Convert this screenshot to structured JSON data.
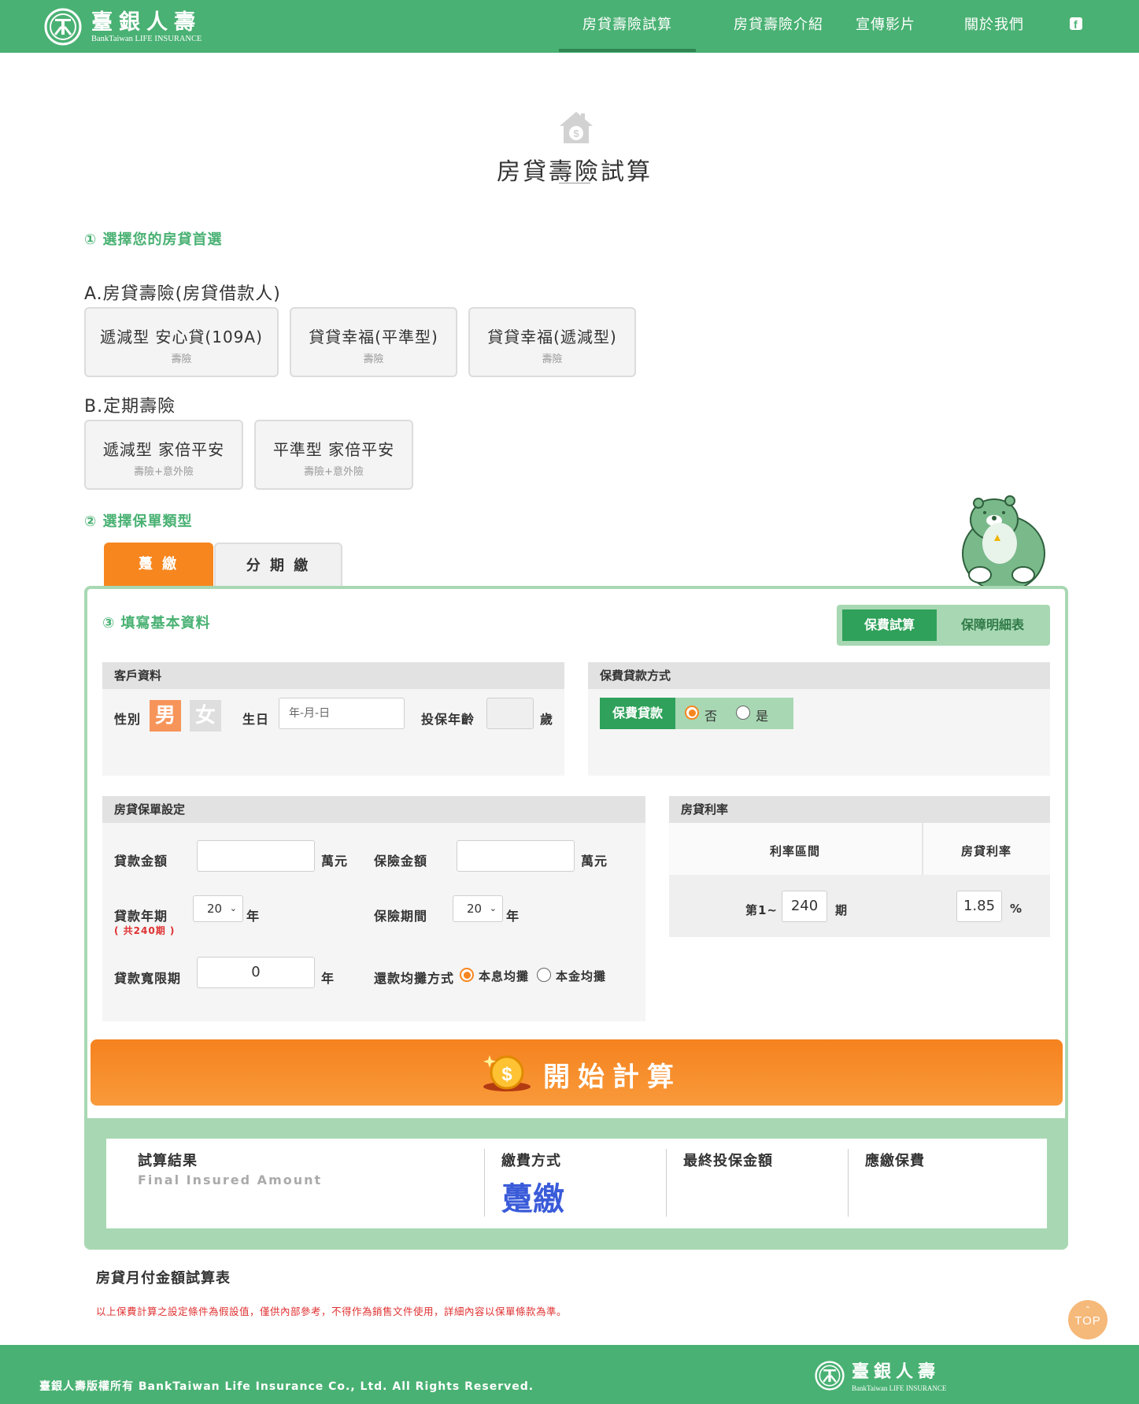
{
  "header": {
    "brand_cn": "臺銀人壽",
    "brand_en": "BankTaiwan LIFE INSURANCE",
    "nav": [
      "房貸壽險試算",
      "房貸壽險介紹",
      "宣傳影片",
      "關於我們"
    ]
  },
  "page_title": "房貸壽險試算",
  "step1": {
    "title": "① 選擇您的房貸首選",
    "group_a": {
      "title": "A.房貸壽險(房貸借款人)",
      "products": [
        {
          "name": "遞減型 安心貸(109A)",
          "sub": "壽險"
        },
        {
          "name": "貸貸幸福(平準型)",
          "sub": "壽險"
        },
        {
          "name": "貸貸幸福(遞減型)",
          "sub": "壽險"
        }
      ]
    },
    "group_b": {
      "title": "B.定期壽險",
      "products": [
        {
          "name": "遞減型 家倍平安",
          "sub": "壽險+意外險"
        },
        {
          "name": "平準型 家倍平安",
          "sub": "壽險+意外險"
        }
      ]
    }
  },
  "step2": {
    "title": "② 選擇保單類型",
    "tabs": [
      "躉 繳",
      "分 期 繳"
    ]
  },
  "step3": {
    "title": "③ 填寫基本資料",
    "toggle": [
      "保費試算",
      "保障明細表"
    ],
    "customer": {
      "heading": "客戶資料",
      "gender_label": "性別",
      "male": "男",
      "female": "女",
      "birthday_label": "生日",
      "birthday_placeholder": "年-月-日",
      "age_label": "投保年齡",
      "age_unit": "歲"
    },
    "premium_loan": {
      "heading": "保費貸款方式",
      "label": "保費貸款",
      "no": "否",
      "yes": "是"
    },
    "policy": {
      "heading": "房貸保單設定",
      "loan_amount_label": "貸款金額",
      "loan_amount_unit": "萬元",
      "insured_amount_label": "保險金額",
      "insured_amount_unit": "萬元",
      "loan_term_label": "貸款年期",
      "loan_term_value": "20",
      "loan_term_unit": "年",
      "loan_term_note": "( 共240期 )",
      "insure_period_label": "保險期間",
      "insure_period_value": "20",
      "insure_period_unit": "年",
      "grace_label": "貸款寬限期",
      "grace_value": "0",
      "grace_unit": "年",
      "repay_label": "還款均攤方式",
      "repay_opt1": "本息均攤",
      "repay_opt2": "本金均攤"
    },
    "rate": {
      "heading": "房貸利率",
      "col1": "利率區間",
      "col2": "房貸利率",
      "period_prefix": "第1~",
      "period_value": "240",
      "period_suffix": "期",
      "rate_value": "1.85",
      "rate_unit": "%"
    }
  },
  "calc_button": "開始計算",
  "result": {
    "title": "試算結果",
    "subtitle": "Final Insured Amount",
    "pay_method_label": "繳費方式",
    "pay_method_value": "躉繳",
    "final_amount_label": "最終投保金額",
    "premium_label": "應繳保費"
  },
  "monthly_title": "房貸月付金額試算表",
  "disclaimer": "以上保費計算之設定條件為假設值，僅供內部參考，不得作為銷售文件使用，詳細內容以保單條款為準。",
  "top_button": "TOP",
  "footer": {
    "copyright": "臺銀人壽版權所有 BankTaiwan Life Insurance Co., Ltd. All Rights Reserved.",
    "brand_cn": "臺銀人壽",
    "brand_en": "BankTaiwan LIFE INSURANCE"
  },
  "colors": {
    "green": "#49b173",
    "orange": "#f7861f",
    "light_green": "#a8d8b3",
    "result_blue": "#3a5bd9"
  }
}
